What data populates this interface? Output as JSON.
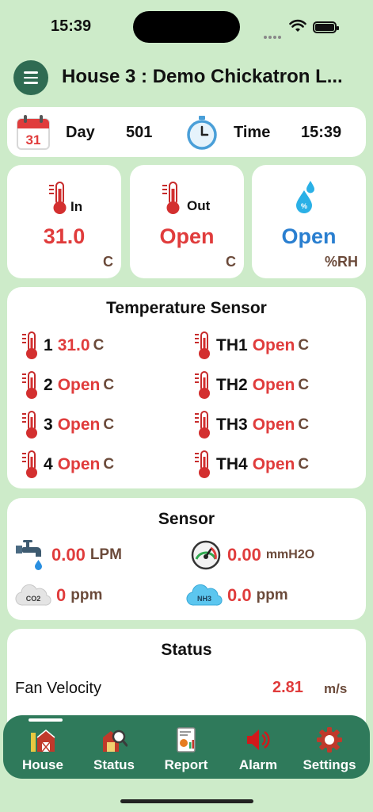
{
  "status_bar": {
    "time": "15:39"
  },
  "header": {
    "title": "House 3 : Demo Chickatron L..."
  },
  "day_time": {
    "day_label": "Day",
    "day_value": "501",
    "time_label": "Time",
    "time_value": "15:39",
    "calendar_number": "31"
  },
  "tiles": [
    {
      "tag": "In",
      "value": "31.0",
      "unit": "C",
      "value_color": "#e03c3c"
    },
    {
      "tag": "Out",
      "value": "Open",
      "unit": "C",
      "value_color": "#e03c3c"
    },
    {
      "tag": "%",
      "value": "Open",
      "unit": "%RH",
      "value_color": "#2a7fd0"
    }
  ],
  "temperature_sensor": {
    "title": "Temperature Sensor",
    "left": [
      {
        "id": "1",
        "value": "31.0",
        "unit": "C"
      },
      {
        "id": "2",
        "value": "Open",
        "unit": "C"
      },
      {
        "id": "3",
        "value": "Open",
        "unit": "C"
      },
      {
        "id": "4",
        "value": "Open",
        "unit": "C"
      }
    ],
    "right": [
      {
        "id": "TH1",
        "value": "Open",
        "unit": "C"
      },
      {
        "id": "TH2",
        "value": "Open",
        "unit": "C"
      },
      {
        "id": "TH3",
        "value": "Open",
        "unit": "C"
      },
      {
        "id": "TH4",
        "value": "Open",
        "unit": "C"
      }
    ]
  },
  "sensor": {
    "title": "Sensor",
    "water": {
      "value": "0.00",
      "unit": "LPM",
      "icon": "water-tap-icon"
    },
    "pressure": {
      "value": "0.00",
      "unit": "mmH2O",
      "icon": "pressure-gauge-icon"
    },
    "co2": {
      "value": "0",
      "unit": "ppm",
      "icon_label": "CO2",
      "icon": "co2-cloud-icon"
    },
    "nh3": {
      "value": "0.0",
      "unit": "ppm",
      "icon_label": "NH3",
      "icon": "nh3-cloud-icon"
    }
  },
  "status": {
    "title": "Status",
    "rows": [
      {
        "label": "Fan Velocity",
        "value": "2.81",
        "unit": "m/s"
      }
    ]
  },
  "tabs": [
    {
      "label": "House",
      "icon": "barn-icon",
      "active": true
    },
    {
      "label": "Status",
      "icon": "status-icon"
    },
    {
      "label": "Report",
      "icon": "report-icon"
    },
    {
      "label": "Alarm",
      "icon": "speaker-icon"
    },
    {
      "label": "Settings",
      "icon": "gear-icon"
    }
  ],
  "colors": {
    "accent": "#2f7a5b",
    "background": "#cdebc9",
    "value_red": "#e03c3c",
    "value_blue": "#2a7fd0",
    "unit_brown": "#6b4a3a"
  }
}
